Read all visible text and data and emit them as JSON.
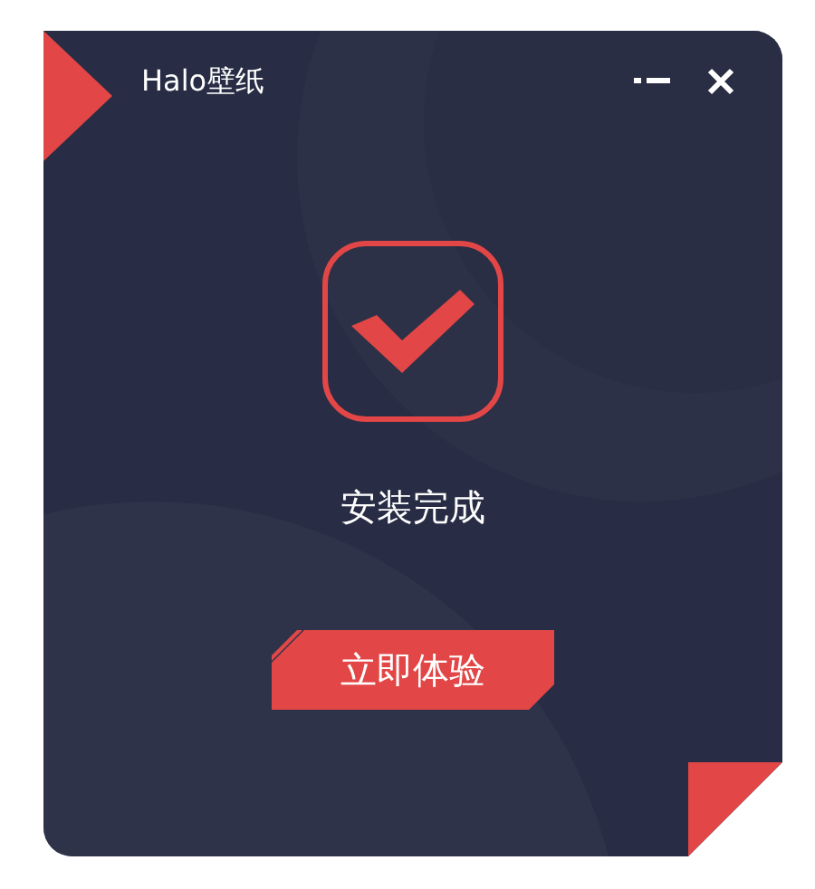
{
  "window": {
    "title": "Halo壁纸"
  },
  "status": {
    "text": "安装完成"
  },
  "buttons": [
    "立即体验"
  ]
}
